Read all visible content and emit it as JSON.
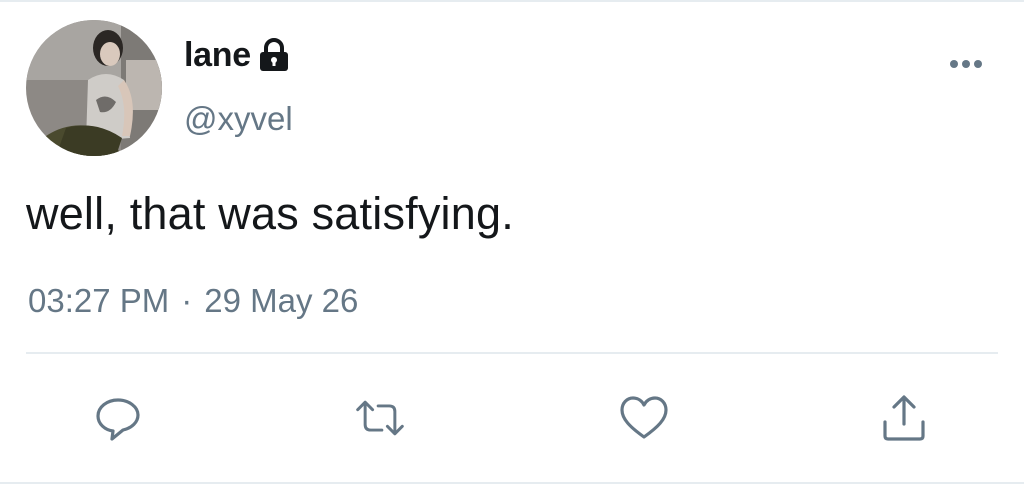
{
  "tweet": {
    "display_name": "lane",
    "handle": "@xyvel",
    "text": "well, that was satisfying.",
    "time": "03:27 PM",
    "separator": "·",
    "date": "29 May 26",
    "protected": true
  },
  "icons": {
    "lock": "lock-icon",
    "more": "more-horizontal-icon",
    "reply": "reply-icon",
    "retweet": "retweet-icon",
    "like": "heart-icon",
    "share": "share-icon"
  },
  "colors": {
    "text_primary": "#14171a",
    "text_secondary": "#657786",
    "divider": "#e6ecf0"
  }
}
